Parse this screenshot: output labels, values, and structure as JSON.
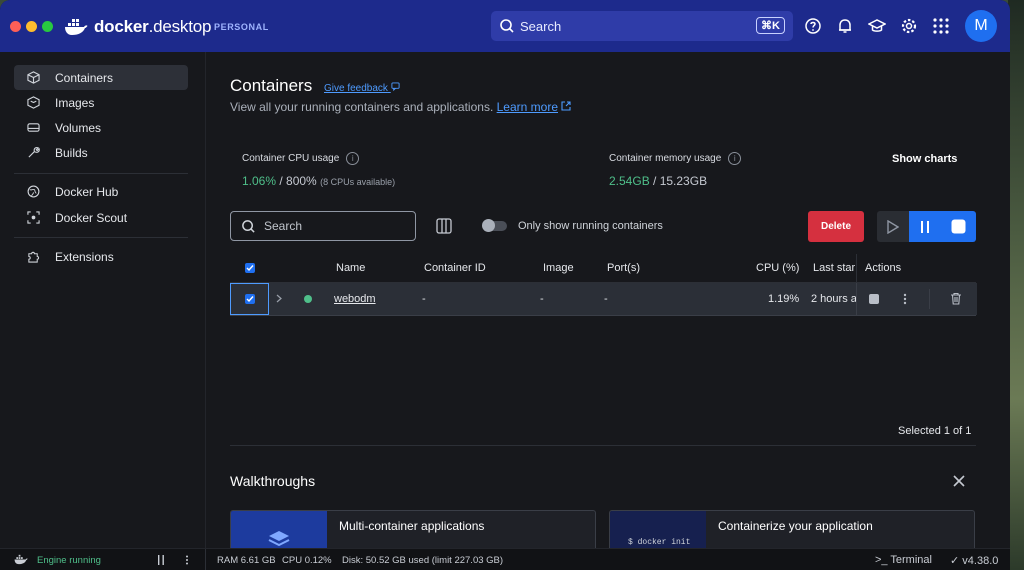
{
  "titlebar": {
    "app_name_bold": "docker",
    "app_name_rest": ".desktop",
    "plan": "PERSONAL",
    "search_placeholder": "Search",
    "search_shortcut": "⌘K",
    "avatar_initial": "M"
  },
  "sidebar": {
    "items": [
      {
        "label": "Containers",
        "icon": "cube-icon",
        "active": true
      },
      {
        "label": "Images",
        "icon": "images-icon"
      },
      {
        "label": "Volumes",
        "icon": "volume-icon"
      },
      {
        "label": "Builds",
        "icon": "wrench-icon"
      },
      {
        "label": "Docker Hub",
        "icon": "globe-icon"
      },
      {
        "label": "Docker Scout",
        "icon": "scout-icon"
      },
      {
        "label": "Extensions",
        "icon": "puzzle-icon"
      }
    ]
  },
  "main": {
    "title": "Containers",
    "feedback": "Give feedback",
    "subtitle": "View all your running containers and applications.",
    "learn_more": "Learn more",
    "cpu": {
      "label": "Container CPU usage",
      "value": "1.06%",
      "total": " / 800%",
      "note": "(8 CPUs available)"
    },
    "memory": {
      "label": "Container memory usage",
      "value": "2.54GB",
      "total": " / 15.23GB"
    },
    "show_charts": "Show charts",
    "search_placeholder": "Search",
    "toggle_label": "Only show running containers",
    "delete_label": "Delete",
    "columns": [
      "Name",
      "Container ID",
      "Image",
      "Port(s)",
      "CPU (%)",
      "Last star",
      "Actions"
    ],
    "rows": [
      {
        "name": "webodm",
        "container_id": "-",
        "image": "-",
        "ports": "-",
        "cpu": "1.19%",
        "last_started": "2 hours a"
      }
    ],
    "selected": "Selected 1 of 1",
    "walkthroughs": "Walkthroughs",
    "cards": [
      {
        "title": "Multi-container applications"
      },
      {
        "title": "Containerize your application",
        "code": "$ docker init"
      }
    ]
  },
  "statusbar": {
    "engine": "Engine running",
    "ram": "RAM 6.61 GB",
    "cpu": "CPU 0.12%",
    "disk": "Disk: 50.52 GB used (limit 227.03 GB)",
    "terminal": "Terminal",
    "version": "v4.38.0"
  },
  "colors": {
    "titlebar": "#1d2a8c",
    "accent": "#1f6ff0",
    "danger": "#d5303f",
    "running": "#4fbf8a"
  }
}
